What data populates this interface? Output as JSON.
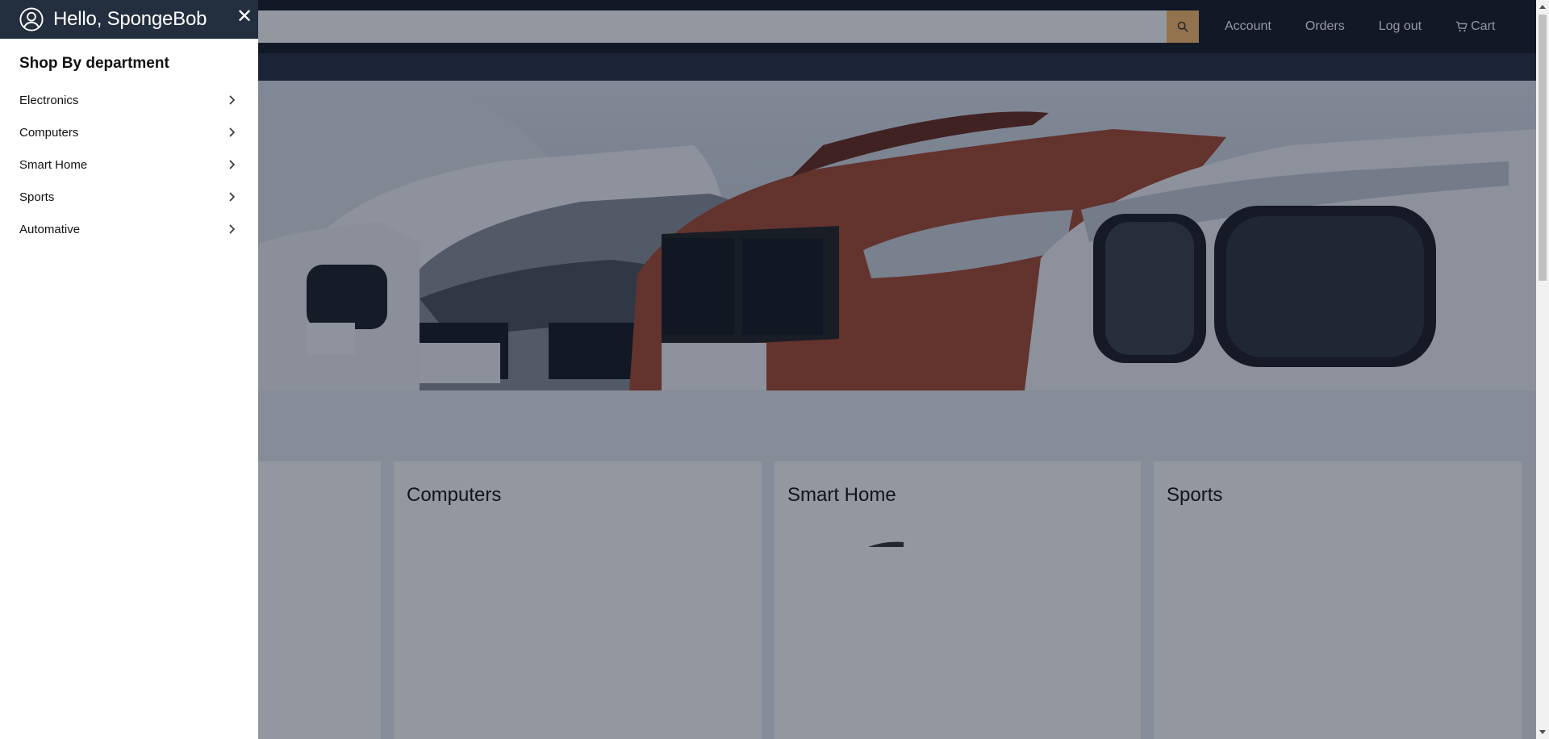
{
  "header": {
    "search_placeholder": "",
    "links": {
      "account": "Account",
      "orders": "Orders",
      "logout": "Log out",
      "cart": "Cart"
    }
  },
  "categories": [
    {
      "title": ""
    },
    {
      "title": "Computers"
    },
    {
      "title": "Smart Home"
    },
    {
      "title": "Sports"
    }
  ],
  "drawer": {
    "greeting": "Hello, SpongeBob",
    "section_title": "Shop By department",
    "departments": [
      {
        "label": "Electronics"
      },
      {
        "label": "Computers"
      },
      {
        "label": "Smart Home"
      },
      {
        "label": "Sports"
      },
      {
        "label": "Automative"
      }
    ]
  },
  "colors": {
    "nav_bg": "#131921",
    "subnav_bg": "#232f3e",
    "search_button": "#febd69",
    "overlay": "rgba(15,25,45,0.45)"
  },
  "icons": {
    "search": "search-icon",
    "cart": "cart-icon",
    "user": "user-circle-icon",
    "close": "close-icon",
    "chevron": "chevron-right-icon"
  }
}
